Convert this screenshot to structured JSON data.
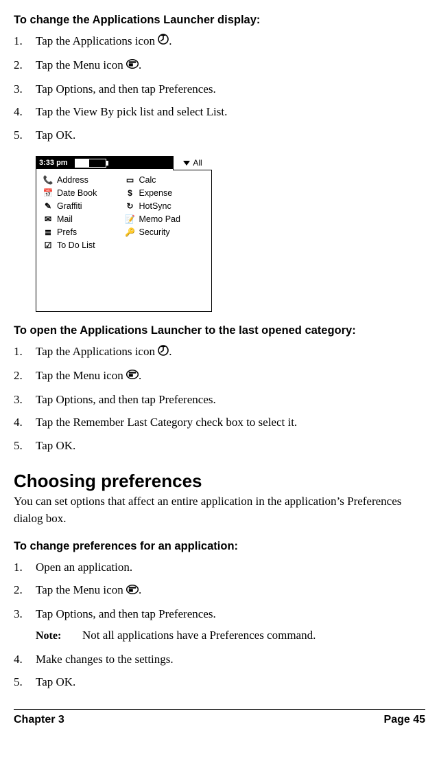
{
  "section1": {
    "heading": "To change the Applications Launcher display:",
    "steps": {
      "s1a": "Tap the Applications icon ",
      "s2a": "Tap the Menu icon ",
      "s3": "Tap Options, and then tap Preferences.",
      "s4": "Tap the View By pick list and select List.",
      "s5": "Tap OK."
    }
  },
  "screenshot": {
    "time": "3:33 pm",
    "category": "All",
    "col1": [
      {
        "ic": "📞",
        "label": "Address"
      },
      {
        "ic": "📅",
        "label": "Date Book"
      },
      {
        "ic": "✎",
        "label": "Graffiti"
      },
      {
        "ic": "✉",
        "label": "Mail"
      },
      {
        "ic": "≣",
        "label": "Prefs"
      },
      {
        "ic": "☑",
        "label": "To Do List"
      }
    ],
    "col2": [
      {
        "ic": "▭",
        "label": "Calc"
      },
      {
        "ic": "$",
        "label": "Expense"
      },
      {
        "ic": "↻",
        "label": "HotSync"
      },
      {
        "ic": "📝",
        "label": "Memo Pad"
      },
      {
        "ic": "🔑",
        "label": "Security"
      }
    ]
  },
  "section2": {
    "heading": "To open the Applications Launcher to the last opened category:",
    "steps": {
      "s1a": "Tap the Applications icon ",
      "s2a": "Tap the Menu icon ",
      "s3": "Tap Options, and then tap Preferences.",
      "s4": "Tap the Remember Last Category check box to select it.",
      "s5": "Tap OK."
    }
  },
  "section3": {
    "title": "Choosing preferences",
    "intro": "You can set options that affect an entire application in the application’s Preferences dialog box.",
    "heading": "To change preferences for an application:",
    "steps": {
      "s1": "Open an application.",
      "s2a": "Tap the Menu icon ",
      "s3": "Tap Options, and then tap Preferences.",
      "noteLabel": "Note:",
      "noteText": "Not all applications have a Preferences command.",
      "s4": "Make changes to the settings.",
      "s5": "Tap OK."
    }
  },
  "footer": {
    "left": "Chapter 3",
    "right": "Page 45"
  },
  "common": {
    "period": "."
  }
}
